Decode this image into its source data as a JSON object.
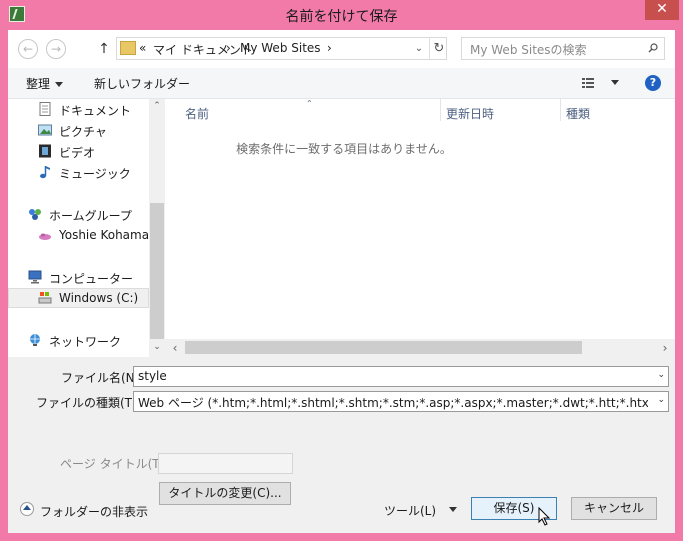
{
  "window": {
    "title": "名前を付けて保存",
    "close_glyph": "✕"
  },
  "address": {
    "back_glyph": "←",
    "forward_glyph": "→",
    "up_glyph": "↑",
    "overflow": "«",
    "crumbs": [
      "マイ ドキュメント",
      "My Web Sites"
    ],
    "separator": "›",
    "dropdown_glyph": "⌄",
    "refresh_glyph": "↻"
  },
  "search": {
    "placeholder": "My Web Sitesの検索"
  },
  "toolbar": {
    "organize": "整理",
    "new_folder": "新しいフォルダー",
    "help_glyph": "?"
  },
  "nav": {
    "items": [
      {
        "label": "ドキュメント",
        "icon": "document-icon"
      },
      {
        "label": "ピクチャ",
        "icon": "pictures-icon"
      },
      {
        "label": "ビデオ",
        "icon": "video-icon"
      },
      {
        "label": "ミュージック",
        "icon": "music-icon"
      },
      {
        "label": "ホームグループ",
        "icon": "homegroup-icon"
      },
      {
        "label": "Yoshie Kohama",
        "icon": "user-icon"
      },
      {
        "label": "コンピューター",
        "icon": "computer-icon"
      },
      {
        "label": "Windows (C:)",
        "icon": "drive-icon"
      },
      {
        "label": "ネットワーク",
        "icon": "network-icon"
      }
    ],
    "scroll_up": "⌃",
    "scroll_down": "⌄"
  },
  "list": {
    "columns": [
      "名前",
      "更新日時",
      "種類"
    ],
    "empty_message": "検索条件に一致する項目はありません。",
    "scroll_left": "‹",
    "scroll_right": "›"
  },
  "form": {
    "filename_label": "ファイル名(N):",
    "filename_value": "style",
    "filetype_label": "ファイルの種類(T):",
    "filetype_value": "Web ページ (*.htm;*.html;*.shtml;*.shtm;*.stm;*.asp;*.aspx;*.master;*.dwt;*.htt;*.htx",
    "page_title_label": "ページ タイトル(T):",
    "change_title_button": "タイトルの変更(C)...",
    "dropdown_glyph": "⌄"
  },
  "footer": {
    "hide_folders": "フォルダーの非表示",
    "tools": "ツール(L)",
    "save": "保存(S)",
    "cancel": "キャンセル"
  },
  "colors": {
    "frame": "#f17aa8",
    "close": "#c7504f",
    "accent": "#1f62c3"
  }
}
